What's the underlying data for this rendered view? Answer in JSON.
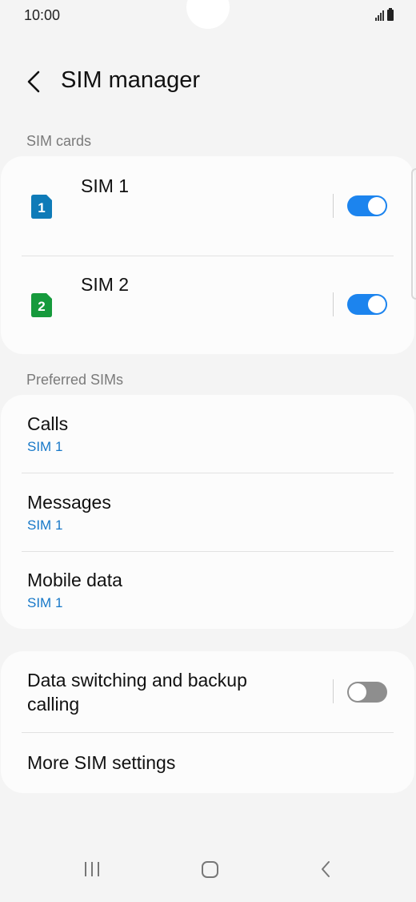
{
  "status_bar": {
    "time": "10:00",
    "icons": [
      "signal-icon",
      "battery-icon"
    ]
  },
  "header": {
    "back_icon": "chevron-left-icon",
    "title": "SIM manager"
  },
  "sim_cards": {
    "section_label": "SIM cards",
    "items": [
      {
        "badge": "1",
        "name": "SIM 1",
        "enabled": true,
        "color": "#0f7bb8"
      },
      {
        "badge": "2",
        "name": "SIM 2",
        "enabled": true,
        "color": "#169a3c"
      }
    ]
  },
  "preferred_sims": {
    "section_label": "Preferred SIMs",
    "items": [
      {
        "title": "Calls",
        "value": "SIM 1"
      },
      {
        "title": "Messages",
        "value": "SIM 1"
      },
      {
        "title": "Mobile data",
        "value": "SIM 1"
      }
    ]
  },
  "other_settings": {
    "data_switching": {
      "label_line1": "Data switching and backup",
      "label_line2": "calling",
      "enabled": false
    },
    "more_settings": {
      "label": "More SIM settings"
    }
  },
  "nav_bar": {
    "icons": [
      "recent-apps-icon",
      "home-icon",
      "back-icon"
    ]
  },
  "colors": {
    "accent": "#1c84ee",
    "link": "#1778c8",
    "background": "#f4f4f4",
    "card": "#fcfcfc"
  }
}
